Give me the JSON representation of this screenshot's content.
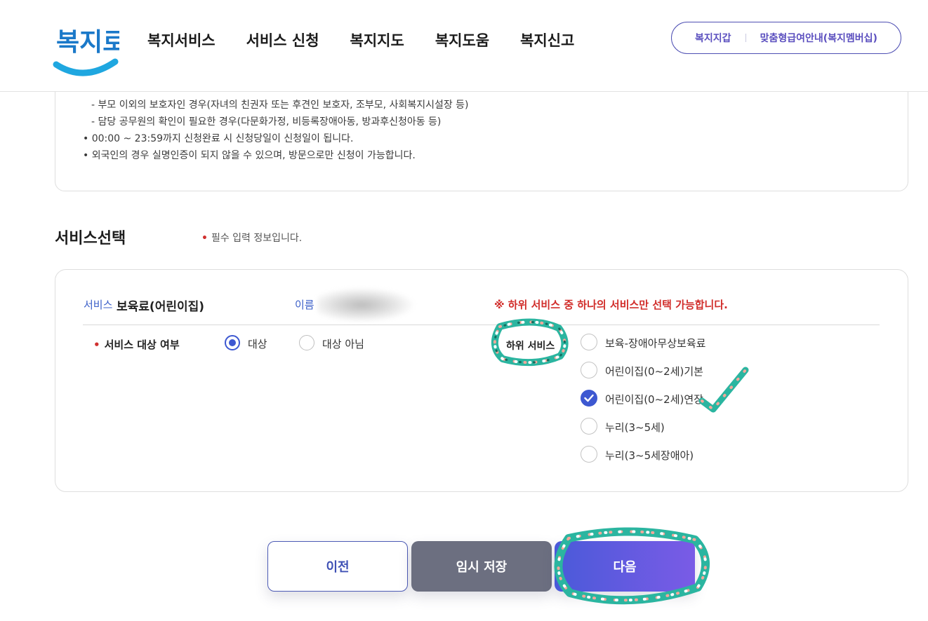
{
  "header": {
    "logo_text": "복지로",
    "nav": [
      "복지서비스",
      "서비스 신청",
      "복지지도",
      "복지도움",
      "복지신고"
    ],
    "links": [
      "복지지갑",
      "맞춤형급여안내(복지멤버십)"
    ]
  },
  "notice": {
    "lines": [
      "- 부모 이외의 보호자인 경우(자녀의 친권자 또는 후견인 보호자, 조부모, 사회복지시설장 등)",
      "- 담당 공무원의 확인이 필요한 경우(다문화가정, 비등록장애아동, 방과후신청아동 등)",
      "• 00:00 ~ 23:59까지 신청완료 시 신청당일이 신청일이 됩니다.",
      "• 외국인의 경우 실명인증이 되지 않을 수 있으며, 방문으로만 신청이 가능합니다."
    ]
  },
  "section": {
    "title": "서비스선택",
    "required_note": "필수 입력 정보입니다.",
    "required_mark": "•"
  },
  "service": {
    "label": "서비스",
    "name": "보육료(어린이집)",
    "name_label": "이름",
    "warning": "※ 하위 서비스 중 하나의 서비스만 선택 가능합니다.",
    "target_label": "서비스 대상 여부",
    "target_options": [
      {
        "label": "대상",
        "selected": true
      },
      {
        "label": "대상 아님",
        "selected": false
      }
    ],
    "sub_label": "하위 서비스",
    "sub_options": [
      {
        "label": "보육-장애아무상보육료",
        "checked": false
      },
      {
        "label": "어린이집(0~2세)기본",
        "checked": false
      },
      {
        "label": "어린이집(0~2세)연장",
        "checked": true
      },
      {
        "label": "누리(3~5세)",
        "checked": false
      },
      {
        "label": "누리(3~5세장애아)",
        "checked": false
      }
    ]
  },
  "buttons": {
    "prev": "이전",
    "save": "임시 저장",
    "next": "다음"
  },
  "colors": {
    "accent": "#3d58d1",
    "warning": "#d12d2a",
    "annotation": "#2bb5a0"
  }
}
